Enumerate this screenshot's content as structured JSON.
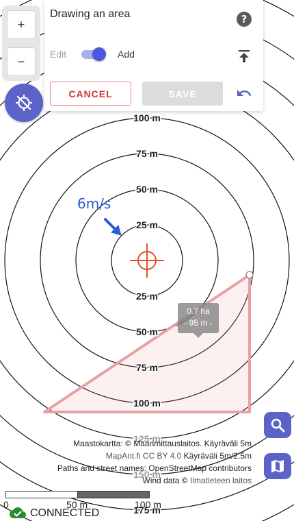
{
  "panel": {
    "title": "Drawing an area",
    "mode_left": "Edit",
    "mode_right": "Add",
    "mode_add_active": true,
    "cancel_label": "CANCEL",
    "save_label": "SAVE",
    "icons": [
      "help-icon",
      "upload-icon",
      "undo-icon"
    ]
  },
  "zoom": {
    "in_label": "+",
    "out_label": "−"
  },
  "map": {
    "ring_labels_upper": [
      "100 m",
      "75 m",
      "50 m",
      "25 m"
    ],
    "ring_labels_lower": [
      "25 m",
      "50 m",
      "75 m",
      "100 m",
      "125 m",
      "150 m",
      "175 m"
    ],
    "wind_label": "6m/s",
    "area_line1": "0.7 ha",
    "area_line2": "- 95 m -",
    "colors": {
      "accent": "#5b63c8",
      "area": "#e9a0a0",
      "target": "#e2502a",
      "wind": "#2a5bd8"
    }
  },
  "attribution": {
    "line1_a": "Maastokartta: © Maanmittauslaitos.",
    "line1_b": "Käyräväli 5m",
    "line2_a": "MapAnt.fi CC BY 4.0",
    "line2_b": "Käyräväli 5m/2.5m",
    "line3": "Paths and street names: OpenStreetMap contributors",
    "line4_a": "Wind data ©",
    "line4_b": "Ilmatieteen laitos"
  },
  "scale": {
    "labels": [
      "0",
      "50 m",
      "100 m"
    ]
  },
  "status": {
    "connection": "CONNECTED",
    "color": "#2e8b2e"
  }
}
